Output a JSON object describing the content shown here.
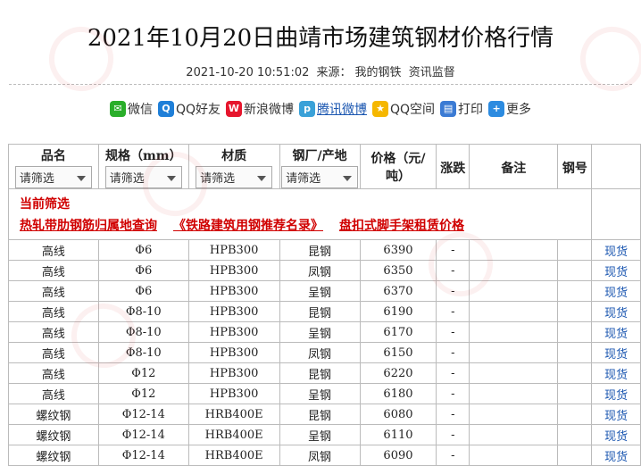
{
  "header": {
    "title": "2021年10月20日曲靖市场建筑钢材价格行情",
    "datetime": "2021-10-20 10:51:02",
    "source_label": "来源：",
    "source_name": "我的钢铁",
    "supervision": "资讯监督"
  },
  "share": [
    {
      "label": "微信",
      "icon": "wechat-icon",
      "color": "#2aae2a"
    },
    {
      "label": "QQ好友",
      "icon": "qq-icon",
      "color": "#1f7fd8"
    },
    {
      "label": "新浪微博",
      "icon": "weibo-icon",
      "color": "#e6162d"
    },
    {
      "label": "腾讯微博",
      "icon": "tencent-weibo-icon",
      "color": "#3aa1d8"
    },
    {
      "label": "QQ空间",
      "icon": "qzone-icon",
      "color": "#f5b700"
    },
    {
      "label": "打印",
      "icon": "print-icon",
      "color": "#3b7bd4"
    },
    {
      "label": "更多",
      "icon": "plus-icon",
      "color": "#2c8be0"
    }
  ],
  "table": {
    "headers": {
      "name": "品名",
      "spec": "规格（mm）",
      "material": "材质",
      "mill": "钢厂/产地",
      "price": "价格（元/吨）",
      "change": "涨跌",
      "remark": "备注",
      "steel_no": "钢号"
    },
    "filter_placeholder": "请筛选",
    "current_filter": "当前筛选",
    "promo_links": [
      "热轧带肋钢筋归属地查询",
      "《铁路建筑用钢推荐名录》",
      "盘扣式脚手架租赁价格"
    ],
    "rows": [
      {
        "name": "高线",
        "spec": "Φ6",
        "material": "HPB300",
        "mill": "昆钢",
        "price": "6390",
        "change": "-",
        "link": "现货"
      },
      {
        "name": "高线",
        "spec": "Φ6",
        "material": "HPB300",
        "mill": "凤钢",
        "price": "6350",
        "change": "-",
        "link": "现货"
      },
      {
        "name": "高线",
        "spec": "Φ6",
        "material": "HPB300",
        "mill": "呈钢",
        "price": "6370",
        "change": "-",
        "link": "现货"
      },
      {
        "name": "高线",
        "spec": "Φ8-10",
        "material": "HPB300",
        "mill": "昆钢",
        "price": "6190",
        "change": "-",
        "link": "现货"
      },
      {
        "name": "高线",
        "spec": "Φ8-10",
        "material": "HPB300",
        "mill": "呈钢",
        "price": "6170",
        "change": "-",
        "link": "现货"
      },
      {
        "name": "高线",
        "spec": "Φ8-10",
        "material": "HPB300",
        "mill": "凤钢",
        "price": "6150",
        "change": "-",
        "link": "现货"
      },
      {
        "name": "高线",
        "spec": "Φ12",
        "material": "HPB300",
        "mill": "昆钢",
        "price": "6220",
        "change": "-",
        "link": "现货"
      },
      {
        "name": "高线",
        "spec": "Φ12",
        "material": "HPB300",
        "mill": "呈钢",
        "price": "6180",
        "change": "-",
        "link": "现货"
      },
      {
        "name": "螺纹钢",
        "spec": "Φ12-14",
        "material": "HRB400E",
        "mill": "昆钢",
        "price": "6080",
        "change": "-",
        "link": "现货"
      },
      {
        "name": "螺纹钢",
        "spec": "Φ12-14",
        "material": "HRB400E",
        "mill": "呈钢",
        "price": "6110",
        "change": "-",
        "link": "现货"
      },
      {
        "name": "螺纹钢",
        "spec": "Φ12-14",
        "material": "HRB400E",
        "mill": "凤钢",
        "price": "6090",
        "change": "-",
        "link": "现货"
      }
    ]
  }
}
